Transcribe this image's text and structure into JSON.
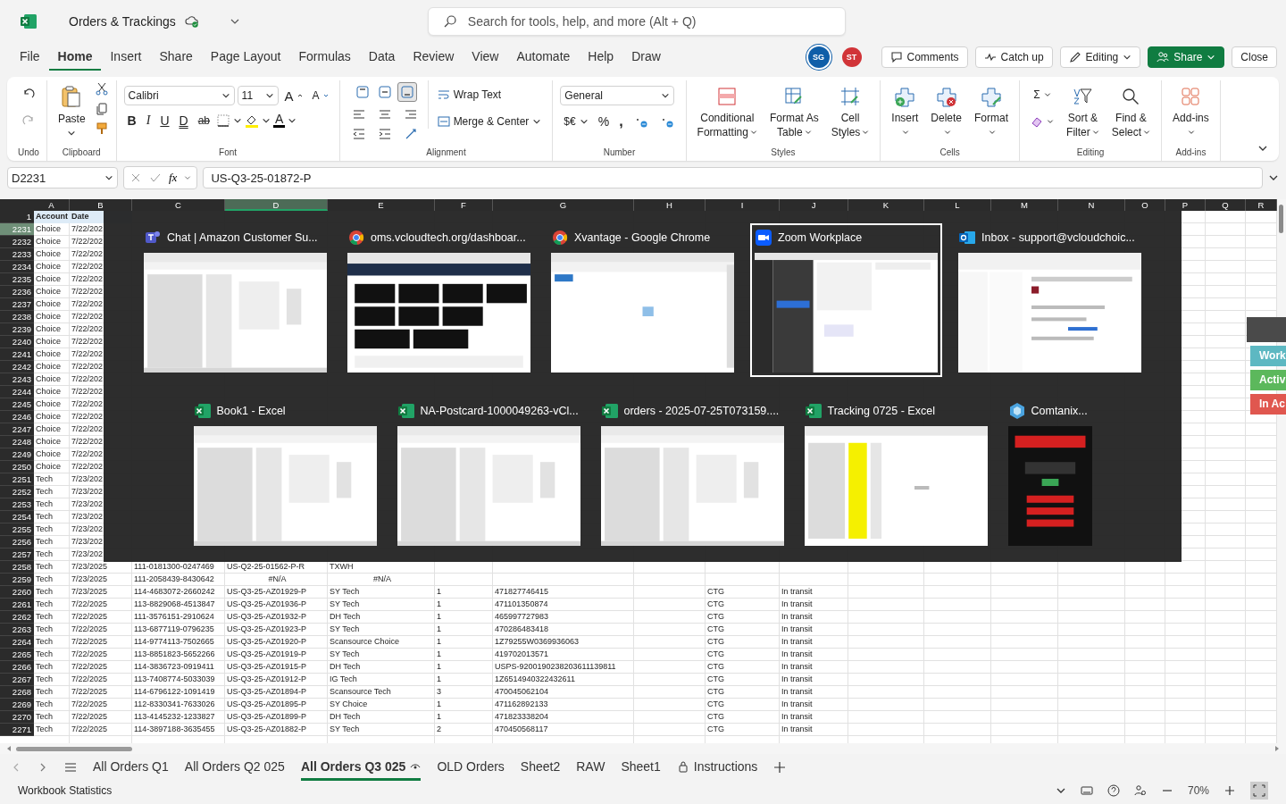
{
  "app": {
    "title": "Orders & Trackings"
  },
  "search": {
    "placeholder": "Search for tools, help, and more (Alt + Q)"
  },
  "menu": [
    {
      "label": "File",
      "selected": false
    },
    {
      "label": "Home",
      "selected": true
    },
    {
      "label": "Insert",
      "selected": false
    },
    {
      "label": "Share",
      "selected": false
    },
    {
      "label": "Page Layout",
      "selected": false
    },
    {
      "label": "Formulas",
      "selected": false
    },
    {
      "label": "Data",
      "selected": false
    },
    {
      "label": "Review",
      "selected": false
    },
    {
      "label": "View",
      "selected": false
    },
    {
      "label": "Automate",
      "selected": false
    },
    {
      "label": "Help",
      "selected": false
    },
    {
      "label": "Draw",
      "selected": false
    }
  ],
  "presence": [
    {
      "initials": "SG",
      "color": "#0f5ea8"
    },
    {
      "initials": "ST",
      "color": "#d13438"
    }
  ],
  "actions": {
    "comments": "Comments",
    "catch_up": "Catch up",
    "editing": "Editing",
    "share": "Share",
    "close": "Close"
  },
  "ribbon": {
    "undo": {
      "label": "Undo"
    },
    "clipboard": {
      "paste": "Paste",
      "label": "Clipboard"
    },
    "font": {
      "family": "Calibri",
      "size": "11",
      "grow": "A",
      "shrink": "A",
      "styles": [
        "B",
        "I",
        "U",
        "D",
        "ab"
      ],
      "color_letter": "A",
      "label": "Font"
    },
    "alignment": {
      "vertical": [
        {
          "selected": false
        },
        {
          "selected": false
        },
        {
          "selected": true
        }
      ],
      "wrap": "Wrap Text",
      "merge": "Merge & Center",
      "label": "Alignment"
    },
    "number": {
      "format": "General",
      "currency": "$€",
      "percent": "%",
      "comma": ",",
      "label": "Number"
    },
    "styles": {
      "items": [
        {
          "lines": [
            "Conditional",
            "Formatting"
          ]
        },
        {
          "lines": [
            "Format As",
            "Table"
          ]
        },
        {
          "lines": [
            "Cell",
            "Styles"
          ]
        }
      ],
      "label": "Styles"
    },
    "cells": {
      "items": [
        "Insert",
        "Delete",
        "Format"
      ],
      "label": "Cells"
    },
    "editing": {
      "sum": "Σ",
      "items": [
        {
          "lines": [
            "Sort &",
            "Filter"
          ]
        },
        {
          "lines": [
            "Find &",
            "Select"
          ]
        }
      ],
      "label": "Editing"
    },
    "addins": {
      "item": "Add-ins",
      "label": "Add-ins"
    }
  },
  "formula_bar": {
    "name_box": "D2231",
    "fx": "fx",
    "value": "US-Q3-25-01872-P"
  },
  "grid": {
    "columns": [
      {
        "letter": "A",
        "selected": false
      },
      {
        "letter": "B",
        "selected": false
      },
      {
        "letter": "C",
        "selected": false
      },
      {
        "letter": "D",
        "selected": true
      },
      {
        "letter": "E",
        "selected": false
      },
      {
        "letter": "F",
        "selected": false
      },
      {
        "letter": "G",
        "selected": false
      },
      {
        "letter": "H",
        "selected": false
      },
      {
        "letter": "I",
        "selected": false
      },
      {
        "letter": "J",
        "selected": false
      },
      {
        "letter": "K",
        "selected": false
      },
      {
        "letter": "L",
        "selected": false
      },
      {
        "letter": "M",
        "selected": false
      },
      {
        "letter": "N",
        "selected": false
      },
      {
        "letter": "O",
        "selected": false
      },
      {
        "letter": "P",
        "selected": false
      },
      {
        "letter": "Q",
        "selected": false
      },
      {
        "letter": "R",
        "selected": false
      }
    ],
    "header_row": {
      "row": "1",
      "account": "Account",
      "date": "Date"
    },
    "rows": [
      {
        "row": "2231",
        "account": "Choice",
        "date": "7/22/202",
        "selected": true
      },
      {
        "row": "2232",
        "account": "Choice",
        "date": "7/22/202",
        "selected": false
      },
      {
        "row": "2233",
        "account": "Choice",
        "date": "7/22/202",
        "selected": false
      },
      {
        "row": "2234",
        "account": "Choice",
        "date": "7/22/202",
        "selected": false
      },
      {
        "row": "2235",
        "account": "Choice",
        "date": "7/22/202",
        "selected": false
      },
      {
        "row": "2236",
        "account": "Choice",
        "date": "7/22/202",
        "selected": false
      },
      {
        "row": "2237",
        "account": "Choice",
        "date": "7/22/202",
        "selected": false
      },
      {
        "row": "2238",
        "account": "Choice",
        "date": "7/22/202",
        "selected": false
      },
      {
        "row": "2239",
        "account": "Choice",
        "date": "7/22/202",
        "selected": false
      },
      {
        "row": "2240",
        "account": "Choice",
        "date": "7/22/202",
        "selected": false
      },
      {
        "row": "2241",
        "account": "Choice",
        "date": "7/22/202",
        "selected": false
      },
      {
        "row": "2242",
        "account": "Choice",
        "date": "7/22/202",
        "selected": false
      },
      {
        "row": "2243",
        "account": "Choice",
        "date": "7/22/202",
        "selected": false
      },
      {
        "row": "2244",
        "account": "Choice",
        "date": "7/22/202",
        "selected": false
      },
      {
        "row": "2245",
        "account": "Choice",
        "date": "7/22/202",
        "selected": false
      },
      {
        "row": "2246",
        "account": "Choice",
        "date": "7/22/202",
        "selected": false
      },
      {
        "row": "2247",
        "account": "Choice",
        "date": "7/22/202",
        "selected": false
      },
      {
        "row": "2248",
        "account": "Choice",
        "date": "7/22/202",
        "selected": false
      },
      {
        "row": "2249",
        "account": "Choice",
        "date": "7/22/202",
        "selected": false
      },
      {
        "row": "2250",
        "account": "Choice",
        "date": "7/22/202",
        "selected": false
      },
      {
        "row": "2251",
        "account": "Tech",
        "date": "7/23/202",
        "selected": false
      },
      {
        "row": "2252",
        "account": "Tech",
        "date": "7/23/202",
        "selected": false
      },
      {
        "row": "2253",
        "account": "Tech",
        "date": "7/23/202",
        "selected": false
      },
      {
        "row": "2254",
        "account": "Tech",
        "date": "7/23/202",
        "selected": false
      },
      {
        "row": "2255",
        "account": "Tech",
        "date": "7/23/202",
        "selected": false
      },
      {
        "row": "2256",
        "account": "Tech",
        "date": "7/23/202",
        "selected": false
      },
      {
        "row": "2257",
        "account": "Tech",
        "date": "7/23/202",
        "selected": false
      },
      {
        "row": "2258",
        "account": "Tech",
        "date": "7/23/2025",
        "order": "111-0181300-0247469",
        "po": "US-Q2-25-01562-P-R",
        "disti": "TXWH",
        "selected": false
      },
      {
        "row": "2259",
        "account": "Tech",
        "date": "7/23/2025",
        "order": "111-2058439-8430642",
        "po": "#N/A",
        "disti": "#N/A",
        "centered": true,
        "selected": false
      },
      {
        "row": "2260",
        "account": "Tech",
        "date": "7/23/2025",
        "order": "114-4683072-2660242",
        "po": "US-Q3-25-AZ01929-P",
        "disti": "SY Tech",
        "qty": "1",
        "tracking": "471827746415",
        "update": "CTG",
        "delivered": "In transit",
        "selected": false
      },
      {
        "row": "2261",
        "account": "Tech",
        "date": "7/22/2025",
        "order": "113-8829068-4513847",
        "po": "US-Q3-25-AZ01936-P",
        "disti": "SY Tech",
        "qty": "1",
        "tracking": "471101350874",
        "update": "CTG",
        "delivered": "In transit",
        "selected": false
      },
      {
        "row": "2262",
        "account": "Tech",
        "date": "7/22/2025",
        "order": "111-3576151-2910624",
        "po": "US-Q3-25-AZ01932-P",
        "disti": "DH Tech",
        "qty": "1",
        "tracking": "465997727983",
        "update": "CTG",
        "delivered": "In transit",
        "selected": false
      },
      {
        "row": "2263",
        "account": "Tech",
        "date": "7/22/2025",
        "order": "113-6877119-0796235",
        "po": "US-Q3-25-AZ01923-P",
        "disti": "SY Tech",
        "qty": "1",
        "tracking": "470286483418",
        "update": "CTG",
        "delivered": "In transit",
        "selected": false
      },
      {
        "row": "2264",
        "account": "Tech",
        "date": "7/22/2025",
        "order": "114-9774113-7502665",
        "po": "US-Q3-25-AZ01920-P",
        "disti": "Scansource Choice",
        "qty": "1",
        "tracking": "1Z79255W0369936063",
        "update": "CTG",
        "delivered": "In transit",
        "selected": false
      },
      {
        "row": "2265",
        "account": "Tech",
        "date": "7/22/2025",
        "order": "113-8851823-5652266",
        "po": "US-Q3-25-AZ01919-P",
        "disti": "SY Tech",
        "qty": "1",
        "tracking": "419702013571",
        "update": "CTG",
        "delivered": "In transit",
        "selected": false
      },
      {
        "row": "2266",
        "account": "Tech",
        "date": "7/22/2025",
        "order": "114-3836723-0919411",
        "po": "US-Q3-25-AZ01915-P",
        "disti": "DH Tech",
        "qty": "1",
        "tracking": "USPS-9200190238203611139811",
        "update": "CTG",
        "delivered": "In transit",
        "selected": false
      },
      {
        "row": "2267",
        "account": "Tech",
        "date": "7/22/2025",
        "order": "113-7408774-5033039",
        "po": "US-Q3-25-AZ01912-P",
        "disti": "IG Tech",
        "qty": "1",
        "tracking": "1Z6514940322432611",
        "update": "CTG",
        "delivered": "In transit",
        "selected": false
      },
      {
        "row": "2268",
        "account": "Tech",
        "date": "7/22/2025",
        "order": "114-6796122-1091419",
        "po": "US-Q3-25-AZ01894-P",
        "disti": "Scansource Tech",
        "qty": "3",
        "tracking": "470045062104",
        "update": "CTG",
        "delivered": "In transit",
        "selected": false
      },
      {
        "row": "2269",
        "account": "Tech",
        "date": "7/22/2025",
        "order": "112-8330341-7633026",
        "po": "US-Q3-25-AZ01895-P",
        "disti": "SY Choice",
        "qty": "1",
        "tracking": "471162892133",
        "update": "CTG",
        "delivered": "In transit",
        "selected": false
      },
      {
        "row": "2270",
        "account": "Tech",
        "date": "7/22/2025",
        "order": "113-4145232-1233827",
        "po": "US-Q3-25-AZ01899-P",
        "disti": "DH Tech",
        "qty": "1",
        "tracking": "471823338204",
        "update": "CTG",
        "delivered": "In transit",
        "selected": false
      },
      {
        "row": "2271",
        "account": "Tech",
        "date": "7/22/2025",
        "order": "114-3897188-3635455",
        "po": "US-Q3-25-AZ01882-P",
        "disti": "SY Tech",
        "qty": "2",
        "tracking": "470450568117",
        "update": "CTG",
        "delivered": "In transit",
        "selected": false
      }
    ]
  },
  "switcher": {
    "windows": [
      {
        "title": "Chat | Amazon Customer Su...",
        "kind": "teams",
        "selected": false
      },
      {
        "title": "oms.vcloudtech.org/dashboar...",
        "kind": "chrome",
        "selected": false
      },
      {
        "title": "Xvantage - Google Chrome",
        "kind": "chrome",
        "selected": false
      },
      {
        "title": "Zoom Workplace",
        "kind": "zoom",
        "selected": true
      },
      {
        "title": "Inbox - support@vcloudchoic...",
        "kind": "outlook",
        "selected": false
      },
      {
        "title": "Book1 - Excel",
        "kind": "excel",
        "selected": false
      },
      {
        "title": "NA-Postcard-1000049263-vCl...",
        "kind": "excel",
        "selected": false
      },
      {
        "title": "orders - 2025-07-25T073159....",
        "kind": "excel",
        "selected": false
      },
      {
        "title": "Tracking 0725 - Excel",
        "kind": "excel",
        "selected": false
      },
      {
        "title": "Comtanix...",
        "kind": "generic",
        "selected": false
      }
    ]
  },
  "side_panel": [
    {
      "label": "Work",
      "color": "#5db8c2"
    },
    {
      "label": "Activ",
      "color": "#5cb85c"
    },
    {
      "label": "In Ac",
      "color": "#e0574f"
    }
  ],
  "sheets": [
    {
      "label": "All Orders Q1",
      "kind": "plain",
      "selected": false
    },
    {
      "label": "All Orders Q2 025",
      "kind": "plain",
      "selected": false
    },
    {
      "label": "All Orders Q3 025",
      "kind": "watched",
      "selected": true
    },
    {
      "label": "OLD Orders",
      "kind": "plain",
      "selected": false
    },
    {
      "label": "Sheet2",
      "kind": "plain",
      "selected": false
    },
    {
      "label": "RAW",
      "kind": "plain",
      "selected": false
    },
    {
      "label": "Sheet1",
      "kind": "plain",
      "selected": false
    },
    {
      "label": "Instructions",
      "kind": "locked",
      "selected": false
    }
  ],
  "status": {
    "left": "Workbook Statistics",
    "zoom": "70%"
  }
}
